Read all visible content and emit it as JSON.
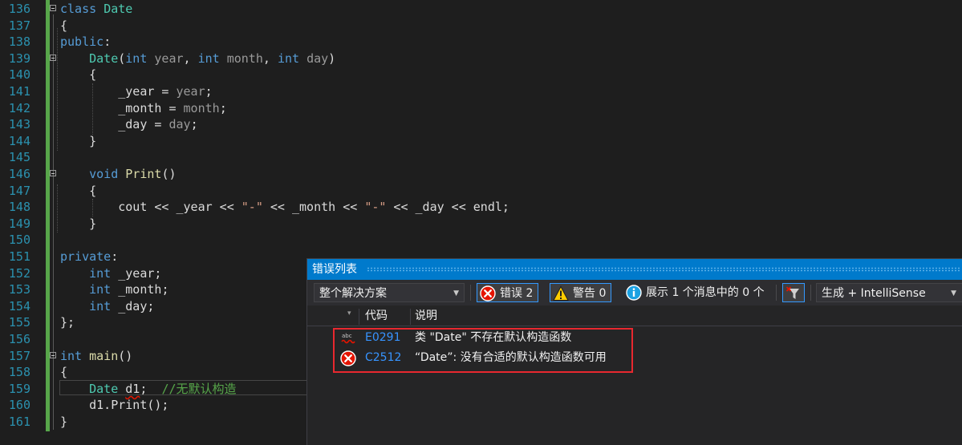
{
  "editor": {
    "lines": [
      {
        "num": "136",
        "tokens": [
          [
            "kw",
            "class"
          ],
          [
            "pl",
            " "
          ],
          [
            "ty",
            "Date"
          ]
        ]
      },
      {
        "num": "137",
        "tokens": [
          [
            "pl",
            "{"
          ]
        ]
      },
      {
        "num": "138",
        "tokens": [
          [
            "kw",
            "public"
          ],
          [
            "pl",
            ":"
          ]
        ]
      },
      {
        "num": "139",
        "tokens": [
          [
            "pl",
            "    "
          ],
          [
            "ty",
            "Date"
          ],
          [
            "pl",
            "("
          ],
          [
            "kw",
            "int"
          ],
          [
            "pl",
            " "
          ],
          [
            "pm",
            "year"
          ],
          [
            "pl",
            ", "
          ],
          [
            "kw",
            "int"
          ],
          [
            "pl",
            " "
          ],
          [
            "pm",
            "month"
          ],
          [
            "pl",
            ", "
          ],
          [
            "kw",
            "int"
          ],
          [
            "pl",
            " "
          ],
          [
            "pm",
            "day"
          ],
          [
            "pl",
            ")"
          ]
        ]
      },
      {
        "num": "140",
        "tokens": [
          [
            "pl",
            "    {"
          ]
        ]
      },
      {
        "num": "141",
        "tokens": [
          [
            "pl",
            "        "
          ],
          [
            "mv",
            "_year"
          ],
          [
            "pl",
            " = "
          ],
          [
            "pm",
            "year"
          ],
          [
            "pl",
            ";"
          ]
        ]
      },
      {
        "num": "142",
        "tokens": [
          [
            "pl",
            "        "
          ],
          [
            "mv",
            "_month"
          ],
          [
            "pl",
            " = "
          ],
          [
            "pm",
            "month"
          ],
          [
            "pl",
            ";"
          ]
        ]
      },
      {
        "num": "143",
        "tokens": [
          [
            "pl",
            "        "
          ],
          [
            "mv",
            "_day"
          ],
          [
            "pl",
            " = "
          ],
          [
            "pm",
            "day"
          ],
          [
            "pl",
            ";"
          ]
        ]
      },
      {
        "num": "144",
        "tokens": [
          [
            "pl",
            "    }"
          ]
        ]
      },
      {
        "num": "145",
        "tokens": []
      },
      {
        "num": "146",
        "tokens": [
          [
            "pl",
            "    "
          ],
          [
            "kw",
            "void"
          ],
          [
            "pl",
            " "
          ],
          [
            "fn",
            "Print"
          ],
          [
            "pl",
            "()"
          ]
        ]
      },
      {
        "num": "147",
        "tokens": [
          [
            "pl",
            "    {"
          ]
        ]
      },
      {
        "num": "148",
        "tokens": [
          [
            "pl",
            "        "
          ],
          [
            "pl",
            "cout"
          ],
          [
            "pl",
            " << "
          ],
          [
            "mv",
            "_year"
          ],
          [
            "pl",
            " << "
          ],
          [
            "st",
            "\"-\""
          ],
          [
            "pl",
            " << "
          ],
          [
            "mv",
            "_month"
          ],
          [
            "pl",
            " << "
          ],
          [
            "st",
            "\"-\""
          ],
          [
            "pl",
            " << "
          ],
          [
            "mv",
            "_day"
          ],
          [
            "pl",
            " << "
          ],
          [
            "pl",
            "endl"
          ],
          [
            "pl",
            ";"
          ]
        ]
      },
      {
        "num": "149",
        "tokens": [
          [
            "pl",
            "    }"
          ]
        ]
      },
      {
        "num": "150",
        "tokens": []
      },
      {
        "num": "151",
        "tokens": [
          [
            "kw",
            "private"
          ],
          [
            "pl",
            ":"
          ]
        ]
      },
      {
        "num": "152",
        "tokens": [
          [
            "pl",
            "    "
          ],
          [
            "kw",
            "int"
          ],
          [
            "pl",
            " "
          ],
          [
            "mv",
            "_year"
          ],
          [
            "pl",
            ";"
          ]
        ]
      },
      {
        "num": "153",
        "tokens": [
          [
            "pl",
            "    "
          ],
          [
            "kw",
            "int"
          ],
          [
            "pl",
            " "
          ],
          [
            "mv",
            "_month"
          ],
          [
            "pl",
            ";"
          ]
        ]
      },
      {
        "num": "154",
        "tokens": [
          [
            "pl",
            "    "
          ],
          [
            "kw",
            "int"
          ],
          [
            "pl",
            " "
          ],
          [
            "mv",
            "_day"
          ],
          [
            "pl",
            ";"
          ]
        ]
      },
      {
        "num": "155",
        "tokens": [
          [
            "pl",
            "};"
          ]
        ]
      },
      {
        "num": "156",
        "tokens": []
      },
      {
        "num": "157",
        "tokens": [
          [
            "kw",
            "int"
          ],
          [
            "pl",
            " "
          ],
          [
            "fn",
            "main"
          ],
          [
            "pl",
            "()"
          ]
        ]
      },
      {
        "num": "158",
        "tokens": [
          [
            "pl",
            "{"
          ]
        ]
      },
      {
        "num": "159",
        "tokens": [
          [
            "pl",
            "    "
          ],
          [
            "ty",
            "Date"
          ],
          [
            "pl",
            " "
          ],
          [
            "sq",
            "d1"
          ],
          [
            "pl",
            ";  "
          ],
          [
            "cm",
            "//无默认构造"
          ]
        ]
      },
      {
        "num": "160",
        "tokens": [
          [
            "pl",
            "    "
          ],
          [
            "pl",
            "d1.Print();"
          ]
        ]
      },
      {
        "num": "161",
        "tokens": [
          [
            "pl",
            "}"
          ]
        ]
      }
    ],
    "fold_lines": [
      "136",
      "139",
      "146",
      "157"
    ]
  },
  "error_list": {
    "title": "错误列表",
    "scope": "整个解决方案",
    "errors_label": "错误 2",
    "warnings_label": "警告 0",
    "messages_label": "展示 1 个消息中的 0 个",
    "build_filter": "生成 + IntelliSense",
    "columns": {
      "code": "代码",
      "description": "说明"
    },
    "rows": [
      {
        "icon": "intellisense-squiggle-icon",
        "code": "E0291",
        "description": "类 \"Date\" 不存在默认构造函数"
      },
      {
        "icon": "error-circle-icon",
        "code": "C2512",
        "description": "“Date”: 没有合适的默认构造函数可用"
      }
    ]
  },
  "colors": {
    "accent": "#007acc",
    "error": "#e51400",
    "highlight_box": "#e8282f",
    "line_numbers": "#2b91af",
    "keyword": "#569cd6",
    "type": "#4ec9b0",
    "comment": "#57a64a"
  }
}
